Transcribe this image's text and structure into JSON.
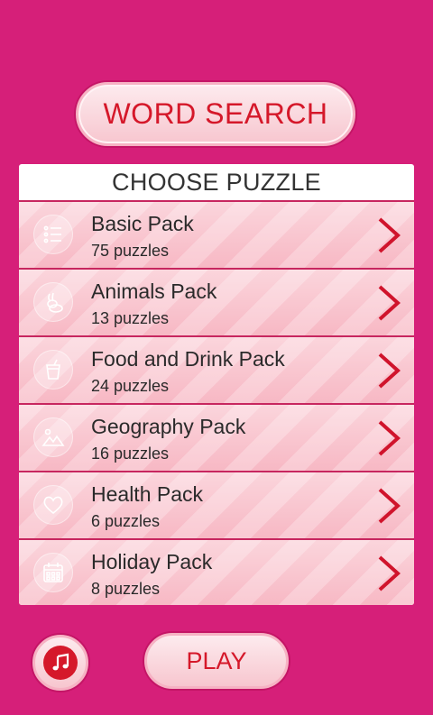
{
  "app": {
    "title": "WORD SEARCH",
    "header": "CHOOSE PUZZLE",
    "play_label": "PLAY"
  },
  "colors": {
    "background": "#d61f79",
    "accent": "#d5182a",
    "row_pink": "#f7b8c4"
  },
  "packs": [
    {
      "name": "Basic Pack",
      "count": "75 puzzles",
      "icon": "list-icon"
    },
    {
      "name": "Animals Pack",
      "count": "13 puzzles",
      "icon": "rabbit-icon"
    },
    {
      "name": "Food and Drink Pack",
      "count": "24 puzzles",
      "icon": "drink-icon"
    },
    {
      "name": "Geography Pack",
      "count": "16 puzzles",
      "icon": "landscape-icon"
    },
    {
      "name": "Health Pack",
      "count": "6 puzzles",
      "icon": "heart-icon"
    },
    {
      "name": "Holiday Pack",
      "count": "8 puzzles",
      "icon": "calendar-icon"
    }
  ],
  "icons": {
    "music": "music-note-icon",
    "chevron": "chevron-right-icon"
  }
}
